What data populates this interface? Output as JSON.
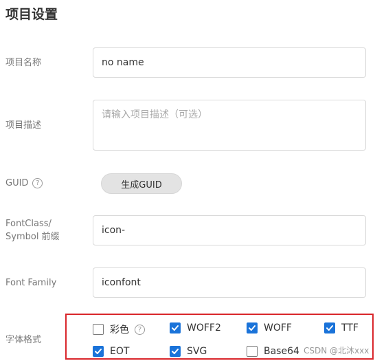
{
  "page": {
    "title": "项目设置"
  },
  "fields": {
    "name": {
      "label": "项目名称",
      "value": "no name"
    },
    "description": {
      "label": "项目描述",
      "placeholder": "请输入项目描述（可选）"
    },
    "guid": {
      "label": "GUID",
      "help": "?",
      "button": "生成GUID"
    },
    "prefix": {
      "label_line1": "FontClass/",
      "label_line2": "Symbol 前缀",
      "value": "icon-"
    },
    "family": {
      "label": "Font Family",
      "value": "iconfont"
    },
    "formats": {
      "label": "字体格式",
      "help": "?",
      "accent_color": "#1a73d9",
      "highlight_color": "#d9262b",
      "options": [
        {
          "label": "彩色",
          "checked": false
        },
        {
          "label": "WOFF2",
          "checked": true
        },
        {
          "label": "WOFF",
          "checked": true
        },
        {
          "label": "TTF",
          "checked": true
        },
        {
          "label": "EOT",
          "checked": true
        },
        {
          "label": "SVG",
          "checked": true
        },
        {
          "label": "Base64",
          "checked": false
        }
      ]
    }
  },
  "watermark": "CSDN @北沐xxx"
}
